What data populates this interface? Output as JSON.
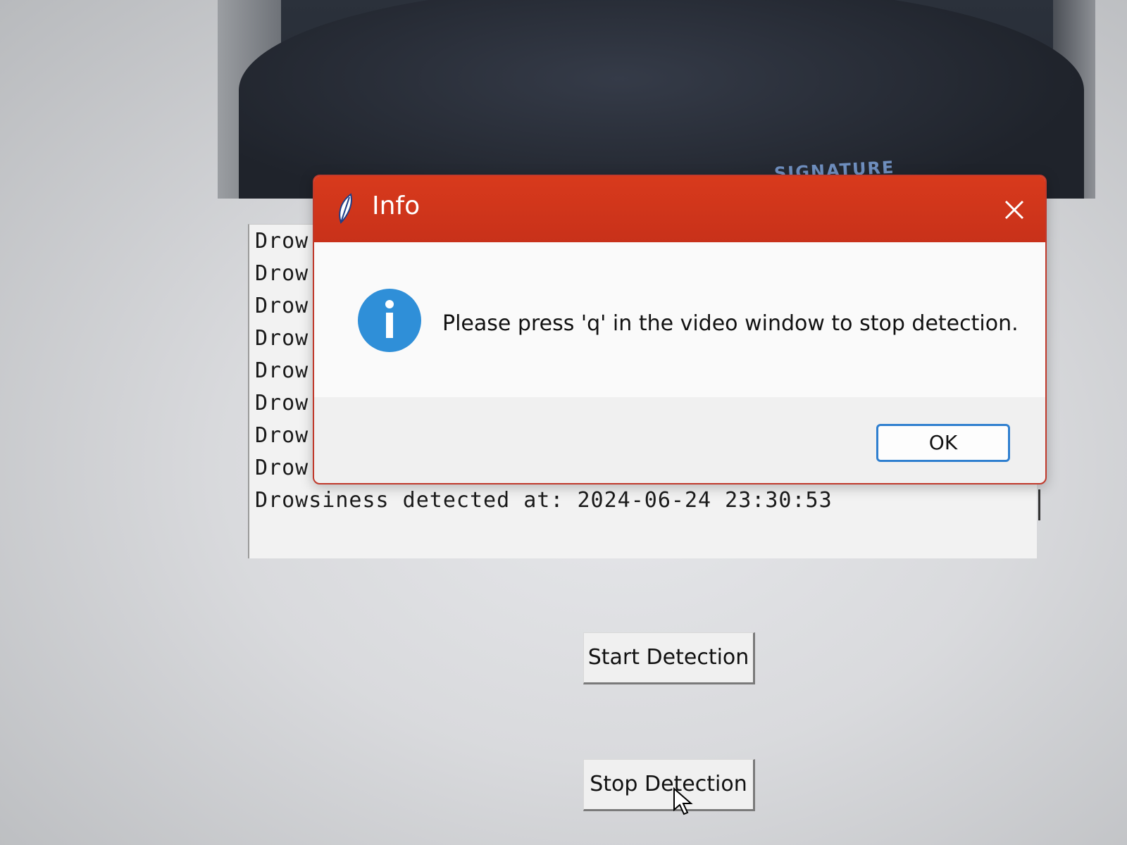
{
  "dialog": {
    "title": "Info",
    "message": "Please press 'q' in the video window to stop detection.",
    "ok_label": "OK"
  },
  "video": {
    "shirt_print": "SIGNATURE"
  },
  "log": {
    "lines": [
      "Drow",
      "Drow",
      "Drow",
      "Drow",
      "Drow",
      "Drow",
      "Drow",
      "Drow",
      "Drowsiness detected at: 2024-06-24 23:30:53"
    ]
  },
  "buttons": {
    "start_label": "Start Detection",
    "stop_label": "Stop Detection"
  },
  "colors": {
    "titlebar": "#d83a1c",
    "ok_border": "#2f7fcf",
    "info_icon": "#2f8fd8"
  },
  "icons": {
    "title": "feather-icon",
    "close": "close-icon",
    "info": "info-icon",
    "cursor": "mouse-pointer-icon"
  }
}
